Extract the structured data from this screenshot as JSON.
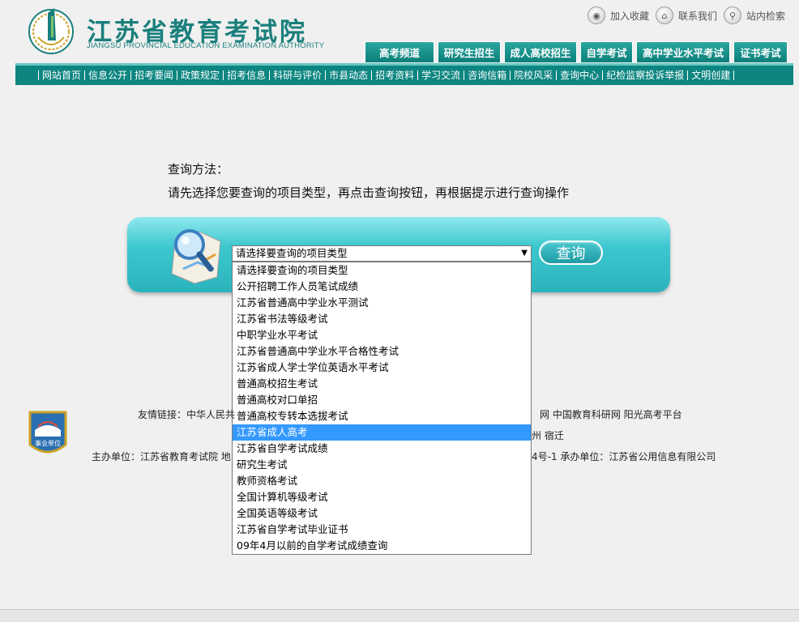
{
  "header": {
    "logo_cn": "江苏省教育考试院",
    "logo_en": "JIANGSU PROVINCIAL EDUCATION EXAMINATION AUTHORITY",
    "top_links": [
      {
        "label": "加入收藏",
        "icon": "bookmark-icon"
      },
      {
        "label": "联系我们",
        "icon": "home-icon"
      },
      {
        "label": "站内检索",
        "icon": "search-icon"
      }
    ],
    "tabs": [
      "高考频道",
      "研究生招生",
      "成人高校招生",
      "自学考试",
      "高中学业水平考试",
      "证书考试"
    ]
  },
  "nav": [
    "网站首页",
    "信息公开",
    "招考要闻",
    "政策规定",
    "招考信息",
    "科研与评价",
    "市县动态",
    "招考资料",
    "学习交流",
    "咨询信箱",
    "院校风采",
    "查询中心",
    "纪检监察投诉举报",
    "文明创建"
  ],
  "main": {
    "method_title": "查询方法：",
    "method_desc": "请先选择您要查询的项目类型，再点击查询按钮，再根据提示进行查询操作",
    "select_value": "请选择要查询的项目类型",
    "query_label": "查询",
    "options": [
      "请选择要查询的项目类型",
      "公开招聘工作人员笔试成绩",
      "江苏省普通高中学业水平测试",
      "江苏省书法等级考试",
      "中职学业水平考试",
      "江苏省普通高中学业水平合格性考试",
      "江苏省成人学士学位英语水平考试",
      "普通高校招生考试",
      "普通高校对口单招",
      "普通高校专转本选拔考试",
      "江苏省成人高考",
      "江苏省自学考试成绩",
      "研究生考试",
      "教师资格考试",
      "全国计算机等级考试",
      "全国英语等级考试",
      "江苏省自学考试毕业证书",
      "09年4月以前的自学考试成绩查询"
    ],
    "highlighted_index": 10
  },
  "footer": {
    "badge_label": "事业单位",
    "friend_links_prefix": "友情链接：中华人民共",
    "friend_links_suffix": "网   中国教育科研网   阳光高考平台",
    "city_suffix": "州   宿迁",
    "host_prefix": "主办单位：江苏省教育考试院   地",
    "host_suffix": "4号-1   承办单位：江苏省公用信息有限公司"
  },
  "colors": {
    "brand": "#0d8580",
    "panel": "#3cc7cf",
    "highlight": "#3399ff"
  }
}
